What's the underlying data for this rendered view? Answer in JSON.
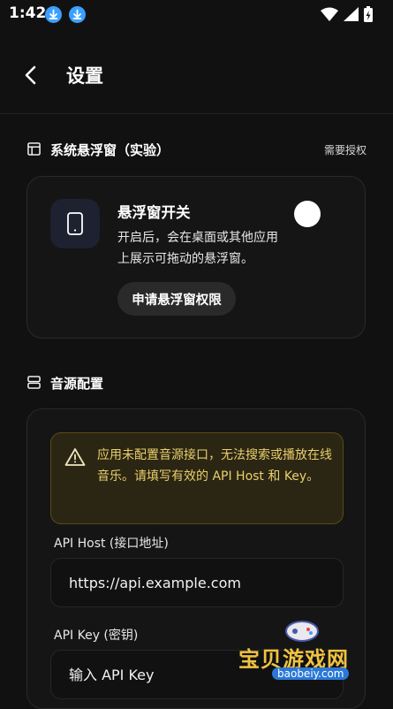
{
  "status_bar": {
    "time": "1:42",
    "notification_icons": [
      "download-icon",
      "download-icon"
    ],
    "indicator_icons": [
      "wifi-icon",
      "signal-icon",
      "battery-charging-icon"
    ]
  },
  "header": {
    "title": "设置",
    "back_icon": "chevron-left-icon"
  },
  "floating_window_section": {
    "title": "系统悬浮窗（实验）",
    "permission_link": "需要授权",
    "card": {
      "title": "悬浮窗开关",
      "description": "开启后，会在桌面或其他应用上展示可拖动的悬浮窗。",
      "toggle_on": false,
      "request_button": "申请悬浮窗权限"
    }
  },
  "audio_source_section": {
    "title": "音源配置",
    "warning_text": "应用未配置音源接口，无法搜索或播放在线音乐。请填写有效的 API Host 和 Key。",
    "api_host_label": "API Host (接口地址)",
    "api_host_placeholder": "https://api.example.com",
    "api_key_label": "API Key (密钥)",
    "api_key_placeholder": "输入 API Key"
  },
  "watermark": {
    "brand": "宝贝游戏网",
    "site": "baobeiy.com"
  },
  "colors": {
    "background": "#111111",
    "card_border": "#2a2a2a",
    "warning_bg": "#2b2614",
    "warning_text": "#e9cf6a",
    "accent_blue": "#3aa0ff"
  }
}
